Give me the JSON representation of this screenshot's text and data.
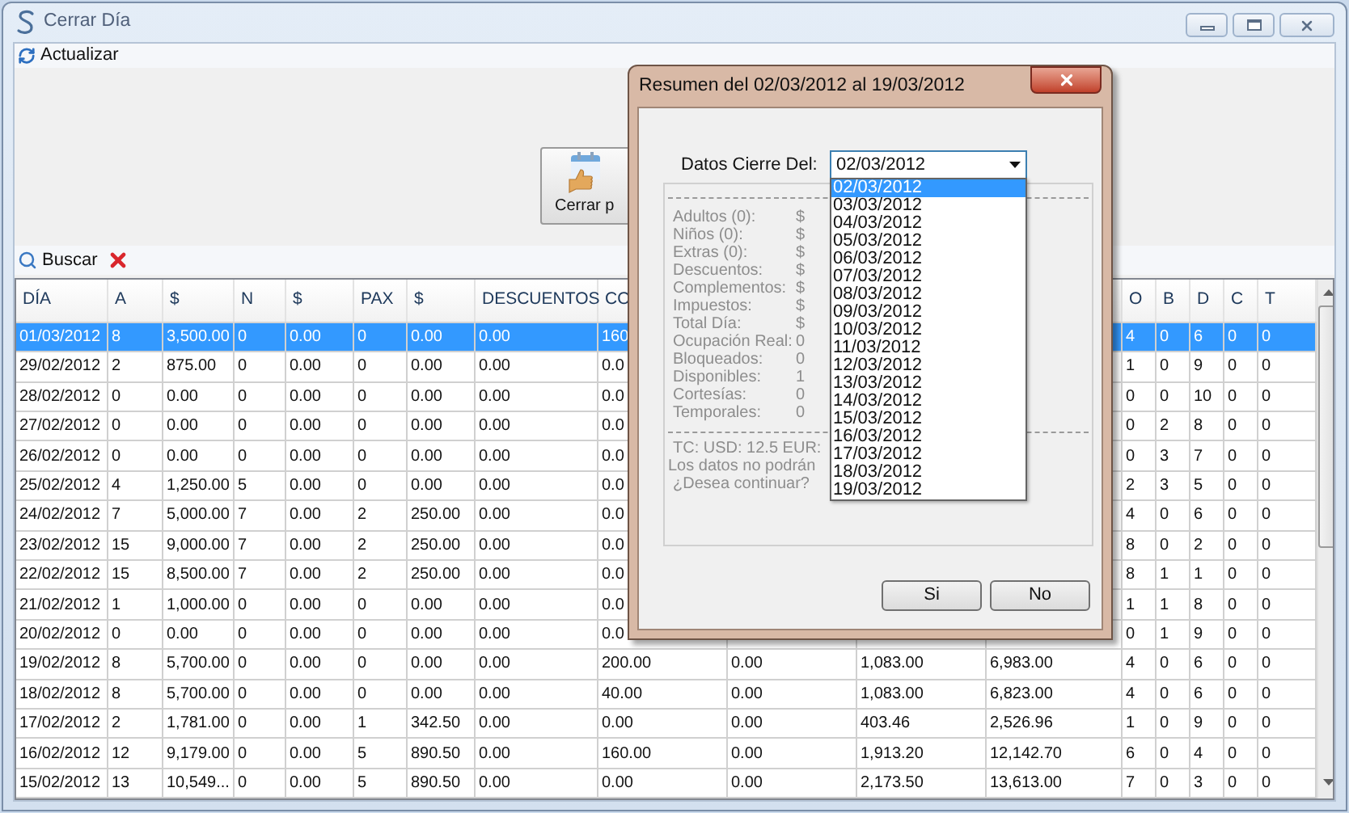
{
  "window": {
    "title": "Cerrar Día"
  },
  "toolbar": {
    "refresh": "Actualizar"
  },
  "action_button": {
    "label": "Cerrar p"
  },
  "search_bar": {
    "search": "Buscar"
  },
  "table": {
    "columns": [
      "DÍA",
      "A",
      "$",
      "N",
      "$",
      "PAX",
      "$",
      "DESCUENTOS",
      "CO",
      null,
      null,
      null,
      "O",
      "B",
      "D",
      "C",
      "T"
    ],
    "rows": [
      {
        "selected": true,
        "cells": [
          "01/03/2012",
          "8",
          "3,500.00",
          "0",
          "0.00",
          "0",
          "0.00",
          "0.00",
          "160",
          null,
          null,
          null,
          "4",
          "0",
          "6",
          "0",
          "0"
        ]
      },
      {
        "selected": false,
        "cells": [
          "29/02/2012",
          "2",
          "875.00",
          "0",
          "0.00",
          "0",
          "0.00",
          "0.00",
          "0.0",
          null,
          null,
          null,
          "1",
          "0",
          "9",
          "0",
          "0"
        ]
      },
      {
        "selected": false,
        "cells": [
          "28/02/2012",
          "0",
          "0.00",
          "0",
          "0.00",
          "0",
          "0.00",
          "0.00",
          "0.0",
          null,
          null,
          null,
          "0",
          "0",
          "10",
          "0",
          "0"
        ]
      },
      {
        "selected": false,
        "cells": [
          "27/02/2012",
          "0",
          "0.00",
          "0",
          "0.00",
          "0",
          "0.00",
          "0.00",
          "0.0",
          null,
          null,
          null,
          "0",
          "2",
          "8",
          "0",
          "0"
        ]
      },
      {
        "selected": false,
        "cells": [
          "26/02/2012",
          "0",
          "0.00",
          "0",
          "0.00",
          "0",
          "0.00",
          "0.00",
          "0.0",
          null,
          null,
          null,
          "0",
          "3",
          "7",
          "0",
          "0"
        ]
      },
      {
        "selected": false,
        "cells": [
          "25/02/2012",
          "4",
          "1,250.00",
          "5",
          "0.00",
          "0",
          "0.00",
          "0.00",
          "0.0",
          null,
          null,
          null,
          "2",
          "3",
          "5",
          "0",
          "0"
        ]
      },
      {
        "selected": false,
        "cells": [
          "24/02/2012",
          "7",
          "5,000.00",
          "7",
          "0.00",
          "2",
          "250.00",
          "0.00",
          "0.0",
          null,
          null,
          null,
          "4",
          "0",
          "6",
          "0",
          "0"
        ]
      },
      {
        "selected": false,
        "cells": [
          "23/02/2012",
          "15",
          "9,000.00",
          "7",
          "0.00",
          "2",
          "250.00",
          "0.00",
          "0.0",
          null,
          null,
          null,
          "8",
          "0",
          "2",
          "0",
          "0"
        ]
      },
      {
        "selected": false,
        "cells": [
          "22/02/2012",
          "15",
          "8,500.00",
          "7",
          "0.00",
          "2",
          "250.00",
          "0.00",
          "0.0",
          null,
          null,
          null,
          "8",
          "1",
          "1",
          "0",
          "0"
        ]
      },
      {
        "selected": false,
        "cells": [
          "21/02/2012",
          "1",
          "1,000.00",
          "0",
          "0.00",
          "0",
          "0.00",
          "0.00",
          "0.0",
          null,
          null,
          null,
          "1",
          "1",
          "8",
          "0",
          "0"
        ]
      },
      {
        "selected": false,
        "cells": [
          "20/02/2012",
          "0",
          "0.00",
          "0",
          "0.00",
          "0",
          "0.00",
          "0.00",
          "0.0",
          null,
          null,
          null,
          "0",
          "1",
          "9",
          "0",
          "0"
        ]
      },
      {
        "selected": false,
        "cells": [
          "19/02/2012",
          "8",
          "5,700.00",
          "0",
          "0.00",
          "0",
          "0.00",
          "0.00",
          "200.00",
          "0.00",
          "1,083.00",
          "6,983.00",
          "4",
          "0",
          "6",
          "0",
          "0"
        ]
      },
      {
        "selected": false,
        "cells": [
          "18/02/2012",
          "8",
          "5,700.00",
          "0",
          "0.00",
          "0",
          "0.00",
          "0.00",
          "40.00",
          "0.00",
          "1,083.00",
          "6,823.00",
          "4",
          "0",
          "6",
          "0",
          "0"
        ]
      },
      {
        "selected": false,
        "cells": [
          "17/02/2012",
          "2",
          "1,781.00",
          "0",
          "0.00",
          "1",
          "342.50",
          "0.00",
          "0.00",
          "0.00",
          "403.46",
          "2,526.96",
          "1",
          "0",
          "9",
          "0",
          "0"
        ]
      },
      {
        "selected": false,
        "cells": [
          "16/02/2012",
          "12",
          "9,179.00",
          "0",
          "0.00",
          "5",
          "890.50",
          "0.00",
          "160.00",
          "0.00",
          "1,913.20",
          "12,142.70",
          "6",
          "0",
          "4",
          "0",
          "0"
        ]
      },
      {
        "selected": false,
        "cells": [
          "15/02/2012",
          "13",
          "10,549...",
          "0",
          "0.00",
          "5",
          "890.50",
          "0.00",
          "0.00",
          "0.00",
          "2,173.50",
          "13,613.00",
          "7",
          "0",
          "3",
          "0",
          "0"
        ]
      }
    ]
  },
  "dialog": {
    "title": "Resumen del 02/03/2012 al 19/03/2012",
    "date_label": "Datos Cierre Del:",
    "date_value": "02/03/2012",
    "dropdown_options": [
      {
        "label": "02/03/2012",
        "selected": true
      },
      {
        "label": "03/03/2012",
        "selected": false
      },
      {
        "label": "04/03/2012",
        "selected": false
      },
      {
        "label": "05/03/2012",
        "selected": false
      },
      {
        "label": "06/03/2012",
        "selected": false
      },
      {
        "label": "07/03/2012",
        "selected": false
      },
      {
        "label": "08/03/2012",
        "selected": false
      },
      {
        "label": "09/03/2012",
        "selected": false
      },
      {
        "label": "10/03/2012",
        "selected": false
      },
      {
        "label": "11/03/2012",
        "selected": false
      },
      {
        "label": "12/03/2012",
        "selected": false
      },
      {
        "label": "13/03/2012",
        "selected": false
      },
      {
        "label": "14/03/2012",
        "selected": false
      },
      {
        "label": "15/03/2012",
        "selected": false
      },
      {
        "label": "16/03/2012",
        "selected": false
      },
      {
        "label": "17/03/2012",
        "selected": false
      },
      {
        "label": "18/03/2012",
        "selected": false
      },
      {
        "label": "19/03/2012",
        "selected": false
      }
    ],
    "summary": {
      "disabled": true,
      "items": [
        {
          "label": "Adultos (0):",
          "value": "$"
        },
        {
          "label": "Niños (0):",
          "value": "$"
        },
        {
          "label": "Extras (0):",
          "value": "$"
        },
        {
          "label": "Descuentos:",
          "value": "$"
        },
        {
          "label": "Complementos:",
          "value": "$"
        },
        {
          "label": "Impuestos:",
          "value": "$"
        },
        {
          "label": "Total Día:",
          "value": "$"
        },
        {
          "label": "Ocupación Real:",
          "value": "0"
        },
        {
          "label": "Bloqueados:",
          "value": "0"
        },
        {
          "label": "Disponibles:",
          "value": "1"
        },
        {
          "label": "Cortesías:",
          "value": "0"
        },
        {
          "label": "Temporales:",
          "value": "0"
        }
      ],
      "notes": [
        "TC: USD: 12.5 EUR:",
        "Los datos no podrán",
        "¿Desea continuar?"
      ]
    },
    "buttons": [
      "Si",
      "No"
    ]
  }
}
